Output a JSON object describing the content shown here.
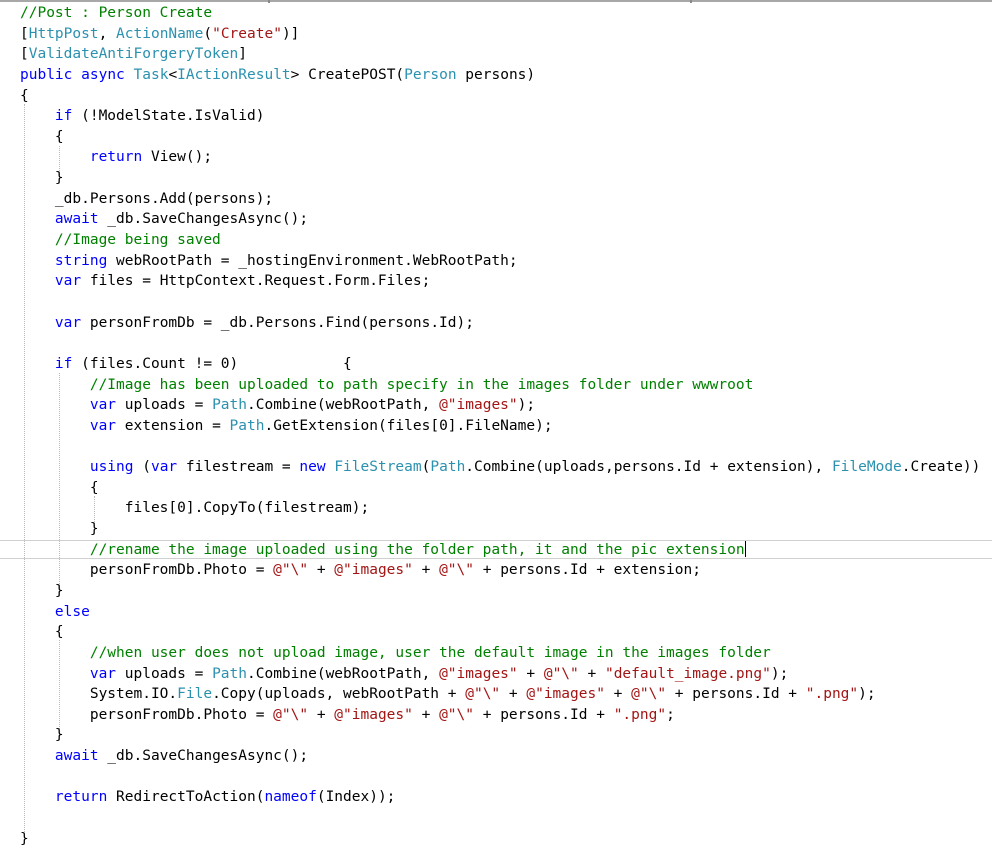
{
  "editor": {
    "language": "csharp",
    "colors": {
      "keyword": "#0000ff",
      "comment": "#008000",
      "type": "#2b91af",
      "string": "#a31515",
      "plain": "#000000",
      "current_line_border": "#d0d0d0"
    },
    "current_line_index": 26,
    "lines": [
      [
        {
          "t": "//Post : Person Create",
          "c": "cm"
        }
      ],
      [
        {
          "t": "[",
          "c": ""
        },
        {
          "t": "HttpPost",
          "c": "ty"
        },
        {
          "t": ", ",
          "c": ""
        },
        {
          "t": "ActionName",
          "c": "ty"
        },
        {
          "t": "(",
          "c": ""
        },
        {
          "t": "\"Create\"",
          "c": "st"
        },
        {
          "t": ")]",
          "c": ""
        }
      ],
      [
        {
          "t": "[",
          "c": ""
        },
        {
          "t": "ValidateAntiForgeryToken",
          "c": "ty"
        },
        {
          "t": "]",
          "c": ""
        }
      ],
      [
        {
          "t": "public",
          "c": "kw"
        },
        {
          "t": " ",
          "c": ""
        },
        {
          "t": "async",
          "c": "kw"
        },
        {
          "t": " ",
          "c": ""
        },
        {
          "t": "Task",
          "c": "ty"
        },
        {
          "t": "<",
          "c": ""
        },
        {
          "t": "IActionResult",
          "c": "ty"
        },
        {
          "t": "> CreatePOST(",
          "c": ""
        },
        {
          "t": "Person",
          "c": "ty"
        },
        {
          "t": " persons)",
          "c": ""
        }
      ],
      [
        {
          "t": "{",
          "c": ""
        }
      ],
      [
        {
          "t": "    ",
          "c": ""
        },
        {
          "t": "if",
          "c": "kw"
        },
        {
          "t": " (!ModelState.IsValid)",
          "c": ""
        }
      ],
      [
        {
          "t": "    {",
          "c": ""
        }
      ],
      [
        {
          "t": "        ",
          "c": ""
        },
        {
          "t": "return",
          "c": "kw"
        },
        {
          "t": " View();",
          "c": ""
        }
      ],
      [
        {
          "t": "    }",
          "c": ""
        }
      ],
      [
        {
          "t": "    _db.Persons.Add(persons);",
          "c": ""
        }
      ],
      [
        {
          "t": "    ",
          "c": ""
        },
        {
          "t": "await",
          "c": "kw"
        },
        {
          "t": " _db.SaveChangesAsync();",
          "c": ""
        }
      ],
      [
        {
          "t": "    ",
          "c": ""
        },
        {
          "t": "//Image being saved",
          "c": "cm"
        }
      ],
      [
        {
          "t": "    ",
          "c": ""
        },
        {
          "t": "string",
          "c": "kw"
        },
        {
          "t": " webRootPath = _hostingEnvironment.WebRootPath;",
          "c": ""
        }
      ],
      [
        {
          "t": "    ",
          "c": ""
        },
        {
          "t": "var",
          "c": "kw"
        },
        {
          "t": " files = HttpContext.Request.Form.Files;",
          "c": ""
        }
      ],
      [
        {
          "t": "",
          "c": ""
        }
      ],
      [
        {
          "t": "    ",
          "c": ""
        },
        {
          "t": "var",
          "c": "kw"
        },
        {
          "t": " personFromDb = _db.Persons.Find(persons.Id);",
          "c": ""
        }
      ],
      [
        {
          "t": "",
          "c": ""
        }
      ],
      [
        {
          "t": "    ",
          "c": ""
        },
        {
          "t": "if",
          "c": "kw"
        },
        {
          "t": " (files.Count != 0)            {",
          "c": ""
        }
      ],
      [
        {
          "t": "        ",
          "c": ""
        },
        {
          "t": "//Image has been uploaded to path specify in the images folder under wwwroot",
          "c": "cm"
        }
      ],
      [
        {
          "t": "        ",
          "c": ""
        },
        {
          "t": "var",
          "c": "kw"
        },
        {
          "t": " uploads = ",
          "c": ""
        },
        {
          "t": "Path",
          "c": "ty"
        },
        {
          "t": ".Combine(webRootPath, ",
          "c": ""
        },
        {
          "t": "@\"images\"",
          "c": "st"
        },
        {
          "t": ");",
          "c": ""
        }
      ],
      [
        {
          "t": "        ",
          "c": ""
        },
        {
          "t": "var",
          "c": "kw"
        },
        {
          "t": " extension = ",
          "c": ""
        },
        {
          "t": "Path",
          "c": "ty"
        },
        {
          "t": ".GetExtension(files[0].FileName);",
          "c": ""
        }
      ],
      [
        {
          "t": "",
          "c": ""
        }
      ],
      [
        {
          "t": "        ",
          "c": ""
        },
        {
          "t": "using",
          "c": "kw"
        },
        {
          "t": " (",
          "c": ""
        },
        {
          "t": "var",
          "c": "kw"
        },
        {
          "t": " filestream = ",
          "c": ""
        },
        {
          "t": "new",
          "c": "kw"
        },
        {
          "t": " ",
          "c": ""
        },
        {
          "t": "FileStream",
          "c": "ty"
        },
        {
          "t": "(",
          "c": ""
        },
        {
          "t": "Path",
          "c": "ty"
        },
        {
          "t": ".Combine(uploads,persons.Id + extension), ",
          "c": ""
        },
        {
          "t": "FileMode",
          "c": "ty"
        },
        {
          "t": ".Create))",
          "c": ""
        }
      ],
      [
        {
          "t": "        {",
          "c": ""
        }
      ],
      [
        {
          "t": "            files[0].CopyTo(filestream);",
          "c": ""
        }
      ],
      [
        {
          "t": "        }",
          "c": ""
        }
      ],
      [
        {
          "t": "        ",
          "c": ""
        },
        {
          "t": "//rename the image uploaded using the folder path, it and the pic extension",
          "c": "cm"
        }
      ],
      [
        {
          "t": "        personFromDb.Photo = ",
          "c": ""
        },
        {
          "t": "@\"\\\"",
          "c": "st"
        },
        {
          "t": " + ",
          "c": ""
        },
        {
          "t": "@\"images\"",
          "c": "st"
        },
        {
          "t": " + ",
          "c": ""
        },
        {
          "t": "@\"\\\"",
          "c": "st"
        },
        {
          "t": " + persons.Id + extension;",
          "c": ""
        }
      ],
      [
        {
          "t": "    }",
          "c": ""
        }
      ],
      [
        {
          "t": "    ",
          "c": ""
        },
        {
          "t": "else",
          "c": "kw"
        }
      ],
      [
        {
          "t": "    {",
          "c": ""
        }
      ],
      [
        {
          "t": "        ",
          "c": ""
        },
        {
          "t": "//when user does not upload image, user the default image in the images folder",
          "c": "cm"
        }
      ],
      [
        {
          "t": "        ",
          "c": ""
        },
        {
          "t": "var",
          "c": "kw"
        },
        {
          "t": " uploads = ",
          "c": ""
        },
        {
          "t": "Path",
          "c": "ty"
        },
        {
          "t": ".Combine(webRootPath, ",
          "c": ""
        },
        {
          "t": "@\"images\"",
          "c": "st"
        },
        {
          "t": " + ",
          "c": ""
        },
        {
          "t": "@\"\\\"",
          "c": "st"
        },
        {
          "t": " + ",
          "c": ""
        },
        {
          "t": "\"default_image.png\"",
          "c": "st"
        },
        {
          "t": ");",
          "c": ""
        }
      ],
      [
        {
          "t": "        System.IO.",
          "c": ""
        },
        {
          "t": "File",
          "c": "ty"
        },
        {
          "t": ".Copy(uploads, webRootPath + ",
          "c": ""
        },
        {
          "t": "@\"\\\"",
          "c": "st"
        },
        {
          "t": " + ",
          "c": ""
        },
        {
          "t": "@\"images\"",
          "c": "st"
        },
        {
          "t": " + ",
          "c": ""
        },
        {
          "t": "@\"\\\"",
          "c": "st"
        },
        {
          "t": " + persons.Id + ",
          "c": ""
        },
        {
          "t": "\".png\"",
          "c": "st"
        },
        {
          "t": ");",
          "c": ""
        }
      ],
      [
        {
          "t": "        personFromDb.Photo = ",
          "c": ""
        },
        {
          "t": "@\"\\\"",
          "c": "st"
        },
        {
          "t": " + ",
          "c": ""
        },
        {
          "t": "@\"images\"",
          "c": "st"
        },
        {
          "t": " + ",
          "c": ""
        },
        {
          "t": "@\"\\\"",
          "c": "st"
        },
        {
          "t": " + persons.Id + ",
          "c": ""
        },
        {
          "t": "\".png\"",
          "c": "st"
        },
        {
          "t": ";",
          "c": ""
        }
      ],
      [
        {
          "t": "    }",
          "c": ""
        }
      ],
      [
        {
          "t": "    ",
          "c": ""
        },
        {
          "t": "await",
          "c": "kw"
        },
        {
          "t": " _db.SaveChangesAsync();",
          "c": ""
        }
      ],
      [
        {
          "t": "",
          "c": ""
        }
      ],
      [
        {
          "t": "    ",
          "c": ""
        },
        {
          "t": "return",
          "c": "kw"
        },
        {
          "t": " RedirectToAction(",
          "c": ""
        },
        {
          "t": "nameof",
          "c": "kw"
        },
        {
          "t": "(Index));",
          "c": ""
        }
      ],
      [
        {
          "t": "",
          "c": ""
        }
      ],
      [
        {
          "t": "}",
          "c": ""
        }
      ]
    ]
  }
}
